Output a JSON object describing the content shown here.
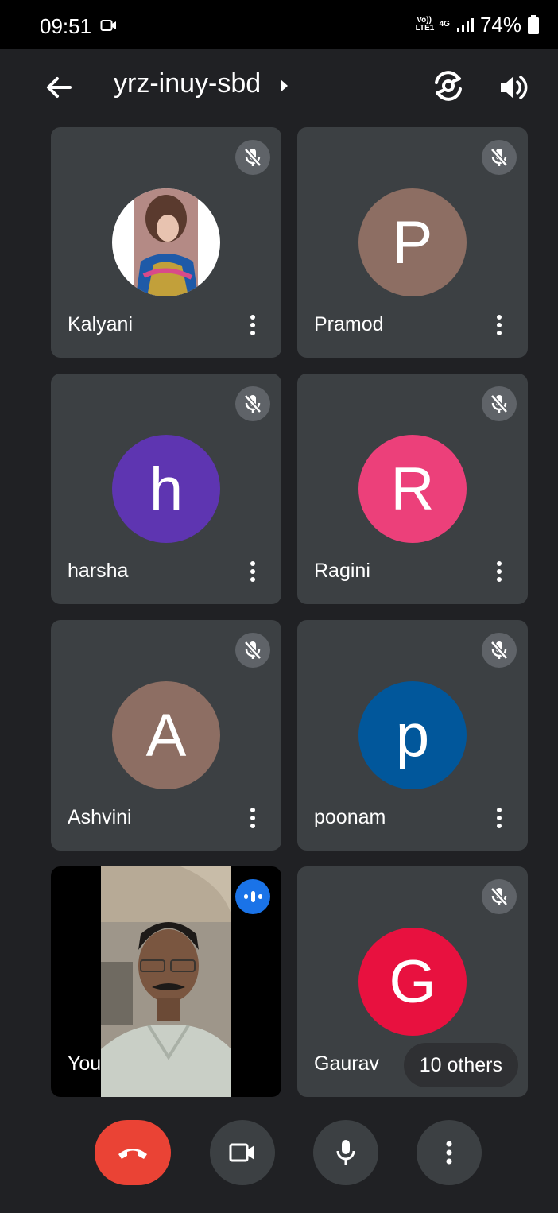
{
  "status_bar": {
    "time": "09:51",
    "volte": "Vo)) LTE1",
    "network": "4G",
    "battery": "74%"
  },
  "header": {
    "meeting_code": "yrz-inuy-sbd"
  },
  "participants": [
    {
      "name": "Kalyani",
      "initial": "",
      "avatar_type": "photo",
      "muted": true
    },
    {
      "name": "Pramod",
      "initial": "P",
      "color": "#8d6e63",
      "muted": true
    },
    {
      "name": "harsha",
      "initial": "h",
      "color": "#5e35b1",
      "muted": true
    },
    {
      "name": "Ragini",
      "initial": "R",
      "color": "#ec407a",
      "muted": true
    },
    {
      "name": "Ashvini",
      "initial": "A",
      "color": "#8d6e63",
      "muted": true
    },
    {
      "name": "poonam",
      "initial": "p",
      "color": "#01579b",
      "muted": true
    },
    {
      "name": "You",
      "initial": "",
      "avatar_type": "video",
      "speaking": true
    },
    {
      "name": "Gaurav",
      "initial": "G",
      "color": "#e8113f",
      "muted": true
    }
  ],
  "others_chip": "10 others",
  "colors": {
    "background": "#202124",
    "tile": "#3c4043",
    "end_call": "#ea4335",
    "speaking": "#1a73e8"
  },
  "controls": [
    "end-call",
    "camera",
    "microphone",
    "more"
  ]
}
